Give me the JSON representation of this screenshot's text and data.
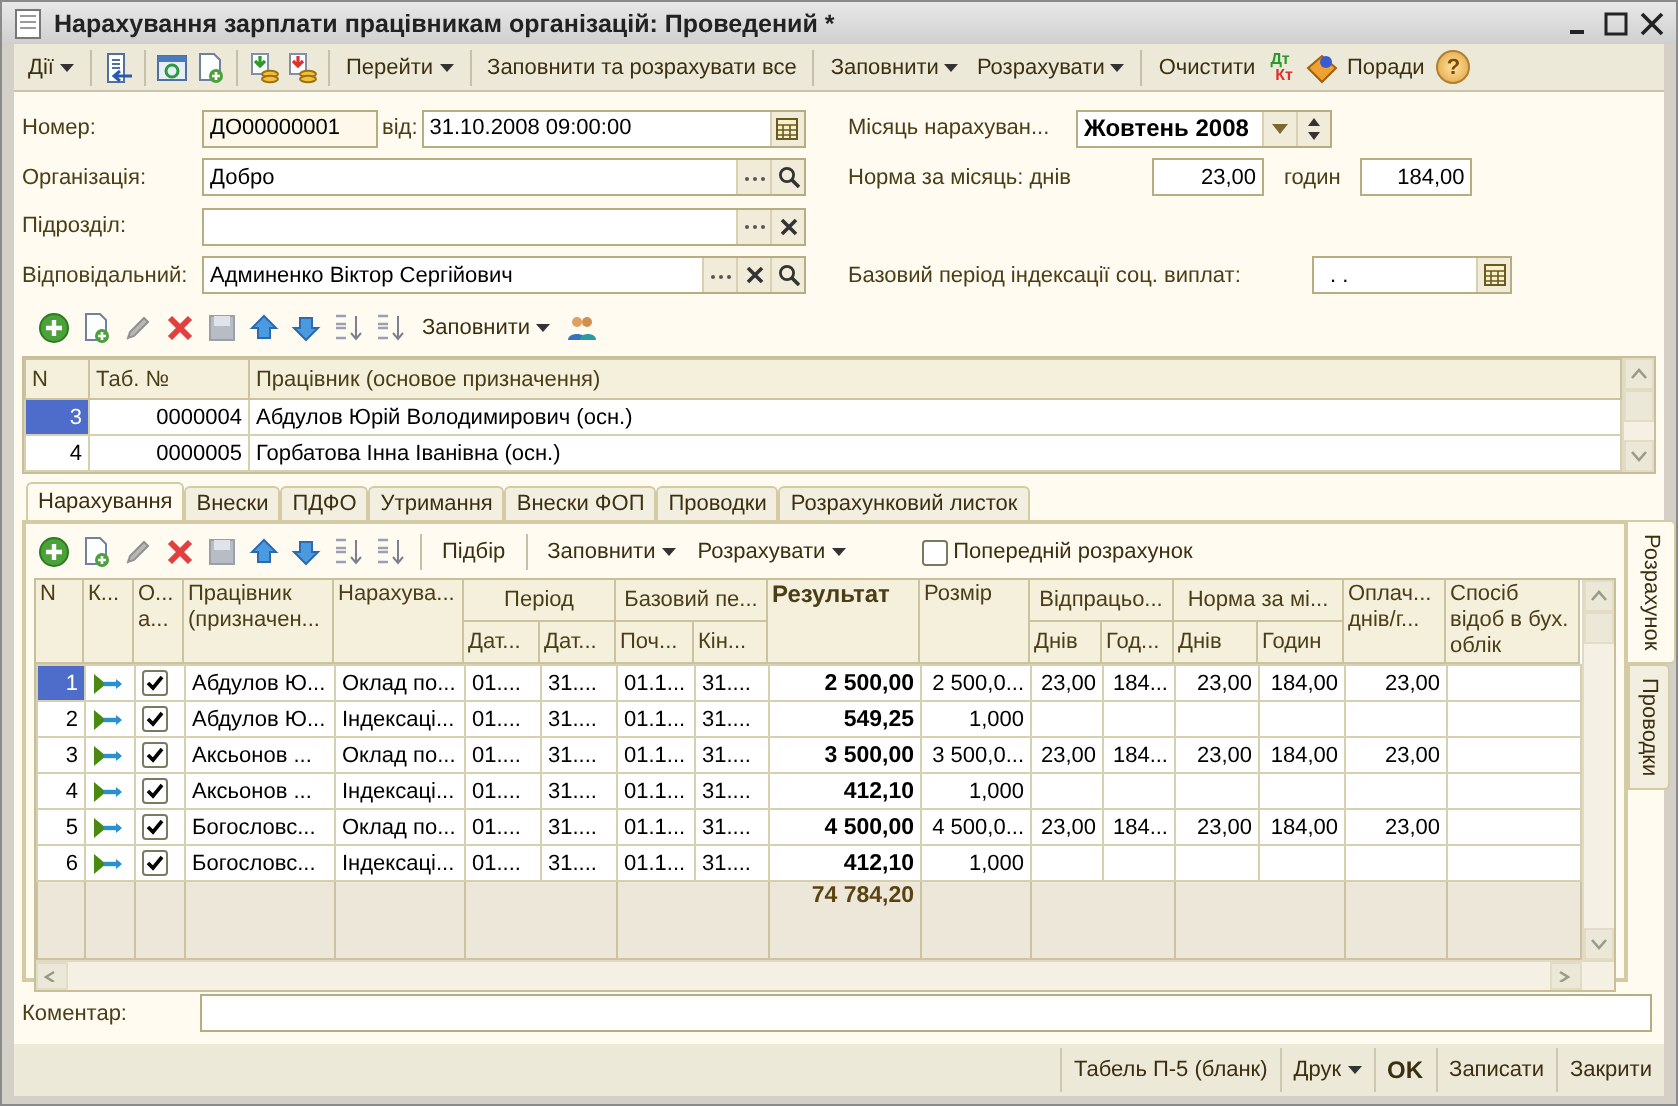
{
  "window": {
    "title": "Нарахування зарплати працівникам організацій: Проведений *"
  },
  "toolbar": {
    "actions": "Дії",
    "go_to": "Перейти",
    "fill_and_calculate_all": "Заповнити та розрахувати все",
    "fill": "Заповнити",
    "calculate": "Розрахувати",
    "clear": "Очистити",
    "debit": "Дт",
    "credit": "Кт",
    "tips": "Поради",
    "help": "?"
  },
  "header": {
    "number_label": "Номер:",
    "number": "ДО00000001",
    "date_label": "від:",
    "date": "31.10.2008 09:00:00",
    "organization_label": "Організація:",
    "organization": "Добро",
    "department_label": "Підрозділ:",
    "responsible_label": "Відповідальний:",
    "responsible": "Админенко Віктор Сергійович",
    "month_label": "Місяць нарахуван...",
    "month": "Жовтень 2008",
    "norm_label": "Норма за місяць: днів",
    "norm_days": "23,00",
    "hours_label": "годин",
    "norm_hours": "184,00",
    "base_period_label": "Базовий період індексації соц. виплат:",
    "base_period": ". ."
  },
  "employees": {
    "fill": "Заповнити",
    "columns": [
      "N",
      "Таб. №",
      "Працівник (основое призначення)"
    ],
    "rows": [
      {
        "n": "3",
        "tab_no": "0000004",
        "name": "Абдулов Юрій Володимирович (осн.)",
        "selected": true
      },
      {
        "n": "4",
        "tab_no": "0000005",
        "name": "Горбатова Інна Іванівна (осн.)",
        "selected": false
      }
    ]
  },
  "tabs": [
    {
      "label": "Нарахування",
      "selected": true
    },
    {
      "label": "Внески",
      "selected": false
    },
    {
      "label": "ПДФО",
      "selected": false
    },
    {
      "label": "Утримання",
      "selected": false
    },
    {
      "label": "Внески ФОП",
      "selected": false
    },
    {
      "label": "Проводки",
      "selected": false
    },
    {
      "label": "Розрахунковий листок",
      "selected": false
    }
  ],
  "side_tabs": [
    {
      "label": "Розрахунок",
      "selected": true
    },
    {
      "label": "Проводки",
      "selected": false
    }
  ],
  "accruals": {
    "pick": "Підбір",
    "fill": "Заповнити",
    "calculate": "Розрахувати",
    "preliminary": {
      "label": "Попередній розрахунок",
      "checked": false
    },
    "columns": [
      {
        "kind": "single",
        "label": "N"
      },
      {
        "kind": "single",
        "label": "К..."
      },
      {
        "kind": "single",
        "label": "О... а..."
      },
      {
        "kind": "single",
        "label": "Працівник (призначен..."
      },
      {
        "kind": "single",
        "label": "Нарахува..."
      },
      {
        "kind": "sub",
        "group": "Період",
        "label": "Дат..."
      },
      {
        "kind": "sub",
        "label": "Дат..."
      },
      {
        "kind": "sub",
        "group": "Базовий пе...",
        "label": "Поч..."
      },
      {
        "kind": "sub",
        "label": "Кін..."
      },
      {
        "kind": "single",
        "label": "Результат"
      },
      {
        "kind": "single",
        "label": "Розмір"
      },
      {
        "kind": "sub",
        "group": "Відпрацьо...",
        "label": "Днів"
      },
      {
        "kind": "sub",
        "label": "Год..."
      },
      {
        "kind": "sub",
        "group": "Норма за мі...",
        "label": "Днів"
      },
      {
        "kind": "sub",
        "label": "Годин"
      },
      {
        "kind": "single",
        "label": "Оплач... днів/г..."
      },
      {
        "kind": "single",
        "label": "Спосіб відоб в бух. облік"
      }
    ],
    "rows": [
      {
        "selected": true,
        "included": true,
        "cells": [
          "1",
          null,
          null,
          "Абдулов Ю...",
          "Оклад по...",
          "01....",
          "31....",
          "01.1...",
          "31....",
          "2 500,00",
          "2 500,0...",
          "23,00",
          "184...",
          "23,00",
          "184,00",
          "23,00",
          null
        ]
      },
      {
        "selected": false,
        "included": true,
        "cells": [
          "2",
          null,
          null,
          "Абдулов Ю...",
          "Індексаці...",
          "01....",
          "31....",
          "01.1...",
          "31....",
          "549,25",
          "1,000",
          null,
          null,
          null,
          null,
          null,
          null
        ]
      },
      {
        "selected": false,
        "included": true,
        "cells": [
          "3",
          null,
          null,
          "Аксьонов ...",
          "Оклад по...",
          "01....",
          "31....",
          "01.1...",
          "31....",
          "3 500,00",
          "3 500,0...",
          "23,00",
          "184...",
          "23,00",
          "184,00",
          "23,00",
          null
        ]
      },
      {
        "selected": false,
        "included": true,
        "cells": [
          "4",
          null,
          null,
          "Аксьонов ...",
          "Індексаці...",
          "01....",
          "31....",
          "01.1...",
          "31....",
          "412,10",
          "1,000",
          null,
          null,
          null,
          null,
          null,
          null
        ]
      },
      {
        "selected": false,
        "included": true,
        "cells": [
          "5",
          null,
          null,
          "Богословс...",
          "Оклад по...",
          "01....",
          "31....",
          "01.1...",
          "31....",
          "4 500,00",
          "4 500,0...",
          "23,00",
          "184...",
          "23,00",
          "184,00",
          "23,00",
          null
        ]
      },
      {
        "selected": false,
        "included": true,
        "cells": [
          "6",
          null,
          null,
          "Богословс...",
          "Індексаці...",
          "01....",
          "31....",
          "01.1...",
          "31....",
          "412,10",
          "1,000",
          null,
          null,
          null,
          null,
          null,
          null
        ]
      }
    ],
    "total": "74 784,20"
  },
  "comment": {
    "label": "Коментар:"
  },
  "buttons": [
    {
      "label": "Табель П-5 (бланк)",
      "kind": "plain"
    },
    {
      "label": "Друк",
      "kind": "menu"
    },
    {
      "label": "OK",
      "kind": "default"
    },
    {
      "label": "Записати",
      "kind": "plain"
    },
    {
      "label": "Закрити",
      "kind": "plain"
    }
  ]
}
